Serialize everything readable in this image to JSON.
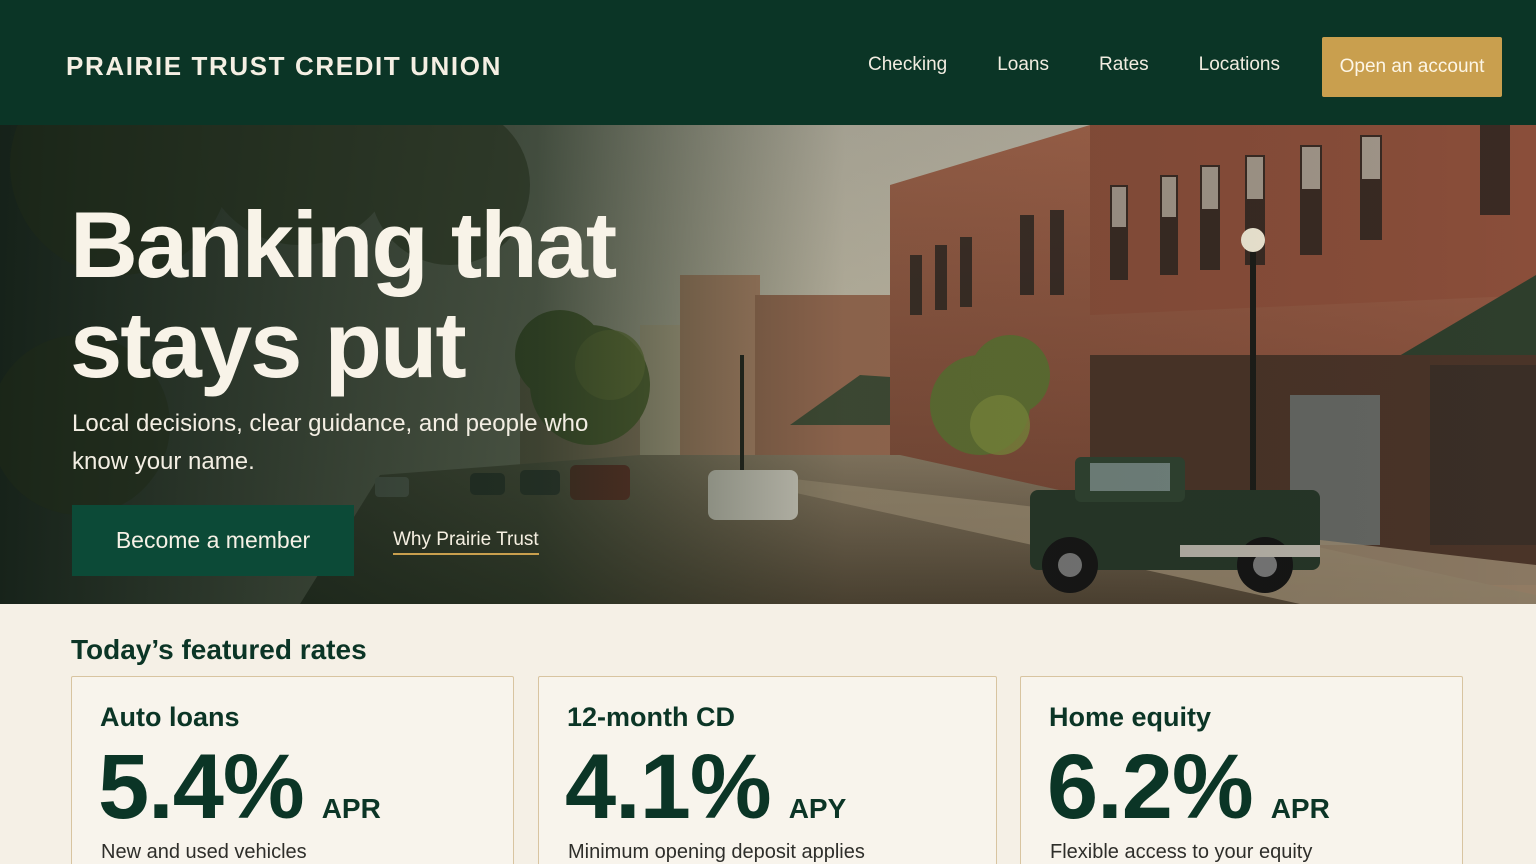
{
  "header": {
    "brand": "PRAIRIE TRUST CREDIT UNION",
    "nav": [
      {
        "label": "Checking"
      },
      {
        "label": "Loans"
      },
      {
        "label": "Rates"
      },
      {
        "label": "Locations"
      }
    ],
    "cta_label": "Open an account"
  },
  "hero": {
    "title_line1": "Banking that",
    "title_line2": "stays put",
    "subtitle": "Local decisions, clear guidance, and people who know your name.",
    "primary_button": "Become a member",
    "secondary_link": "Why Prairie Trust",
    "image_description_icon": "main-street-photo"
  },
  "rates": {
    "heading": "Today’s featured rates",
    "cards": [
      {
        "label": "Auto loans",
        "value": "5.4%",
        "unit": "APR",
        "desc": "New and used vehicles"
      },
      {
        "label": "12-month CD",
        "value": "4.1%",
        "unit": "APY",
        "desc": "Minimum opening deposit applies"
      },
      {
        "label": "Home equity",
        "value": "6.2%",
        "unit": "APR",
        "desc": "Flexible access to your equity"
      }
    ]
  },
  "colors": {
    "brand_green": "#0b3526",
    "button_green": "#0c4a37",
    "gold_accent": "#c99f4e",
    "page_cream": "#f5f0e6"
  }
}
